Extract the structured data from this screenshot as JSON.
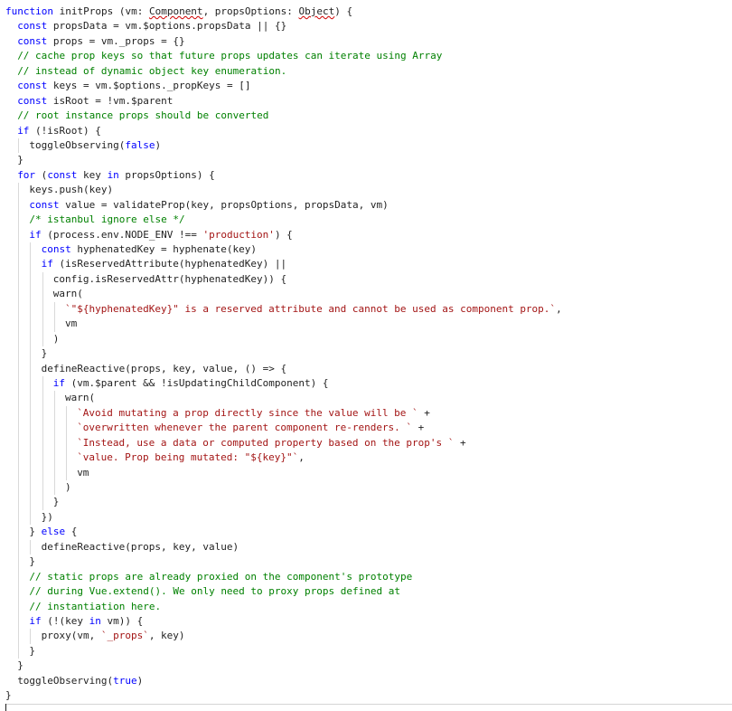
{
  "editor": {
    "language": "javascript",
    "colors": {
      "background": "#ffffff",
      "keyword": "#0000ff",
      "comment": "#008000",
      "string": "#a31515",
      "text": "#1f1f1f",
      "indent_guide": "#d9d9d9",
      "error_squiggle": "#d00000"
    },
    "lines": [
      {
        "indent": 0,
        "tokens": [
          [
            "kw",
            "function"
          ],
          [
            "id",
            " initProps (vm: "
          ],
          [
            "err",
            "Component"
          ],
          [
            "id",
            ", propsOptions: "
          ],
          [
            "err",
            "Object"
          ],
          [
            "id",
            ") {"
          ]
        ]
      },
      {
        "indent": 1,
        "tokens": [
          [
            "kw",
            "const"
          ],
          [
            "id",
            " propsData = vm.$options.propsData || {}"
          ]
        ]
      },
      {
        "indent": 1,
        "tokens": [
          [
            "kw",
            "const"
          ],
          [
            "id",
            " props = vm._props = {}"
          ]
        ]
      },
      {
        "indent": 1,
        "tokens": [
          [
            "cm",
            "// cache prop keys so that future props updates can iterate using Array"
          ]
        ]
      },
      {
        "indent": 1,
        "tokens": [
          [
            "cm",
            "// instead of dynamic object key enumeration."
          ]
        ]
      },
      {
        "indent": 1,
        "tokens": [
          [
            "kw",
            "const"
          ],
          [
            "id",
            " keys = vm.$options._propKeys = []"
          ]
        ]
      },
      {
        "indent": 1,
        "tokens": [
          [
            "kw",
            "const"
          ],
          [
            "id",
            " isRoot = !vm.$parent"
          ]
        ]
      },
      {
        "indent": 1,
        "tokens": [
          [
            "cm",
            "// root instance props should be converted"
          ]
        ]
      },
      {
        "indent": 1,
        "tokens": [
          [
            "kw",
            "if"
          ],
          [
            "id",
            " (!isRoot) {"
          ]
        ]
      },
      {
        "indent": 2,
        "tokens": [
          [
            "id",
            "toggleObserving("
          ],
          [
            "kw",
            "false"
          ],
          [
            "id",
            ")"
          ]
        ]
      },
      {
        "indent": 1,
        "tokens": [
          [
            "id",
            "}"
          ]
        ]
      },
      {
        "indent": 1,
        "tokens": [
          [
            "kw",
            "for"
          ],
          [
            "id",
            " ("
          ],
          [
            "kw",
            "const"
          ],
          [
            "id",
            " key "
          ],
          [
            "kw",
            "in"
          ],
          [
            "id",
            " propsOptions) {"
          ]
        ]
      },
      {
        "indent": 2,
        "tokens": [
          [
            "id",
            "keys.push(key)"
          ]
        ]
      },
      {
        "indent": 2,
        "tokens": [
          [
            "kw",
            "const"
          ],
          [
            "id",
            " value = validateProp(key, propsOptions, propsData, vm)"
          ]
        ]
      },
      {
        "indent": 2,
        "tokens": [
          [
            "cm",
            "/* istanbul ignore else */"
          ]
        ]
      },
      {
        "indent": 2,
        "tokens": [
          [
            "kw",
            "if"
          ],
          [
            "id",
            " (process.env.NODE_ENV !== "
          ],
          [
            "st",
            "'production'"
          ],
          [
            "id",
            ") {"
          ]
        ]
      },
      {
        "indent": 3,
        "tokens": [
          [
            "kw",
            "const"
          ],
          [
            "id",
            " hyphenatedKey = hyphenate(key)"
          ]
        ]
      },
      {
        "indent": 3,
        "tokens": [
          [
            "kw",
            "if"
          ],
          [
            "id",
            " (isReservedAttribute(hyphenatedKey) ||"
          ]
        ]
      },
      {
        "indent": 4,
        "tokens": [
          [
            "id",
            "config.isReservedAttr(hyphenatedKey)) {"
          ]
        ]
      },
      {
        "indent": 4,
        "tokens": [
          [
            "id",
            "warn("
          ]
        ]
      },
      {
        "indent": 5,
        "tokens": [
          [
            "st",
            "`\"${hyphenatedKey}\" is a reserved attribute and cannot be used as component prop.`"
          ],
          [
            "id",
            ","
          ]
        ]
      },
      {
        "indent": 5,
        "tokens": [
          [
            "id",
            "vm"
          ]
        ]
      },
      {
        "indent": 4,
        "tokens": [
          [
            "id",
            ")"
          ]
        ]
      },
      {
        "indent": 3,
        "tokens": [
          [
            "id",
            "}"
          ]
        ]
      },
      {
        "indent": 3,
        "tokens": [
          [
            "id",
            "defineReactive(props, key, value, () => {"
          ]
        ]
      },
      {
        "indent": 4,
        "tokens": [
          [
            "kw",
            "if"
          ],
          [
            "id",
            " (vm.$parent && !isUpdatingChildComponent) {"
          ]
        ]
      },
      {
        "indent": 5,
        "tokens": [
          [
            "id",
            "warn("
          ]
        ]
      },
      {
        "indent": 6,
        "tokens": [
          [
            "st",
            "`Avoid mutating a prop directly since the value will be `"
          ],
          [
            "id",
            " +"
          ]
        ]
      },
      {
        "indent": 6,
        "tokens": [
          [
            "st",
            "`overwritten whenever the parent component re-renders. `"
          ],
          [
            "id",
            " +"
          ]
        ]
      },
      {
        "indent": 6,
        "tokens": [
          [
            "st",
            "`Instead, use a data or computed property based on the prop's `"
          ],
          [
            "id",
            " +"
          ]
        ]
      },
      {
        "indent": 6,
        "tokens": [
          [
            "st",
            "`value. Prop being mutated: \"${key}\"`"
          ],
          [
            "id",
            ","
          ]
        ]
      },
      {
        "indent": 6,
        "tokens": [
          [
            "id",
            "vm"
          ]
        ]
      },
      {
        "indent": 5,
        "tokens": [
          [
            "id",
            ")"
          ]
        ]
      },
      {
        "indent": 4,
        "tokens": [
          [
            "id",
            "}"
          ]
        ]
      },
      {
        "indent": 3,
        "tokens": [
          [
            "id",
            "})"
          ]
        ]
      },
      {
        "indent": 2,
        "tokens": [
          [
            "id",
            "} "
          ],
          [
            "kw",
            "else"
          ],
          [
            "id",
            " {"
          ]
        ]
      },
      {
        "indent": 3,
        "tokens": [
          [
            "id",
            "defineReactive(props, key, value)"
          ]
        ]
      },
      {
        "indent": 2,
        "tokens": [
          [
            "id",
            "}"
          ]
        ]
      },
      {
        "indent": 2,
        "tokens": [
          [
            "cm",
            "// static props are already proxied on the component's prototype"
          ]
        ]
      },
      {
        "indent": 2,
        "tokens": [
          [
            "cm",
            "// during Vue.extend(). We only need to proxy props defined at"
          ]
        ]
      },
      {
        "indent": 2,
        "tokens": [
          [
            "cm",
            "// instantiation here."
          ]
        ]
      },
      {
        "indent": 2,
        "tokens": [
          [
            "kw",
            "if"
          ],
          [
            "id",
            " (!(key "
          ],
          [
            "kw",
            "in"
          ],
          [
            "id",
            " vm)) {"
          ]
        ]
      },
      {
        "indent": 3,
        "tokens": [
          [
            "id",
            "proxy(vm, "
          ],
          [
            "st",
            "`_props`"
          ],
          [
            "id",
            ", key)"
          ]
        ]
      },
      {
        "indent": 2,
        "tokens": [
          [
            "id",
            "}"
          ]
        ]
      },
      {
        "indent": 1,
        "tokens": [
          [
            "id",
            "}"
          ]
        ]
      },
      {
        "indent": 1,
        "tokens": [
          [
            "id",
            "toggleObserving("
          ],
          [
            "kw",
            "true"
          ],
          [
            "id",
            ")"
          ]
        ]
      },
      {
        "indent": 0,
        "tokens": [
          [
            "id",
            "}"
          ]
        ]
      }
    ]
  }
}
